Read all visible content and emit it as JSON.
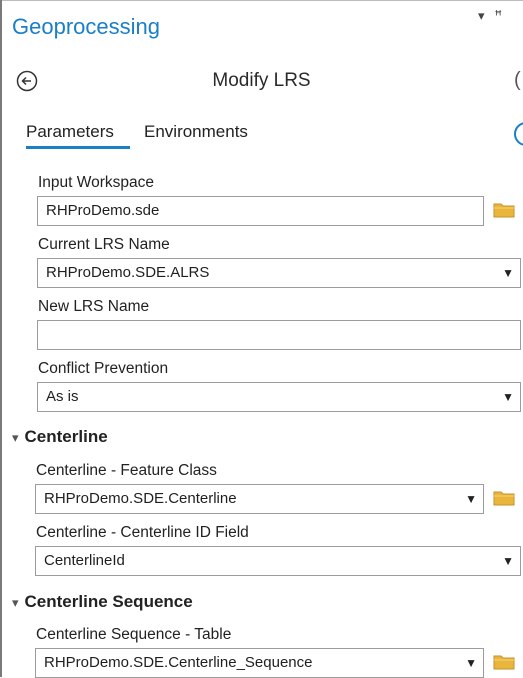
{
  "pane": {
    "title": "Geoprocessing",
    "pin_glyph": "▾ ꟸ"
  },
  "tool": {
    "title": "Modify LRS"
  },
  "tabs": [
    {
      "label": "Parameters"
    },
    {
      "label": "Environments"
    }
  ],
  "params": {
    "input_workspace": {
      "label": "Input Workspace",
      "value": "RHProDemo.sde"
    },
    "current_lrs": {
      "label": "Current LRS Name",
      "value": "RHProDemo.SDE.ALRS"
    },
    "new_lrs": {
      "label": "New LRS Name",
      "value": ""
    },
    "conflict_prevention": {
      "label": "Conflict Prevention",
      "value": "As is"
    }
  },
  "groups": {
    "centerline": {
      "title": "Centerline",
      "feature_class": {
        "label": "Centerline - Feature Class",
        "value": "RHProDemo.SDE.Centerline"
      },
      "id_field": {
        "label": "Centerline - Centerline ID Field",
        "value": "CenterlineId"
      }
    },
    "centerline_sequence": {
      "title": "Centerline Sequence",
      "table": {
        "label": "Centerline Sequence - Table",
        "value": "RHProDemo.SDE.Centerline_Sequence"
      }
    }
  },
  "icons": {
    "folder": "folder-icon",
    "dropdown": "chevron-down-icon",
    "back": "back-arrow-icon"
  },
  "colors": {
    "accent": "#1a7ec8",
    "folder": "#e9b53c"
  }
}
